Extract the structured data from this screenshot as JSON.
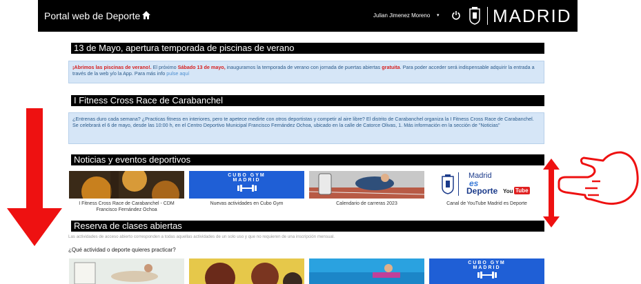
{
  "header": {
    "title": "Portal web de Deporte",
    "user_name": "Julian Jimenez Moreno",
    "caret": "▾",
    "brand": "MADRID"
  },
  "sections": {
    "pools": {
      "heading": "13 de Mayo, apertura temporada de piscinas de verano",
      "p1_highlight": "¡Abrimos las piscinas de verano!.",
      "p1_a": " El próximo ",
      "p1_date": "Sábado 13 de mayo,",
      "p1_b": " inauguramos la temporada de verano con jornada de puertas abiertas ",
      "p1_free": "gratuita",
      "p1_c": ". Para poder acceder será indispensable adquirir la entrada a través de la web y/o la App. Para más info ",
      "p1_link": "pulse aquí"
    },
    "fitness": {
      "heading": "I Fitness Cross Race de Carabanchel",
      "body": "¿Entrenas duro cada semana? ¿Practicas fitness en interiores, pero te apetece medirte con otros deportistas y competir al aire libre? El distrito de Carabanchel organiza la I Fitness Cross Race de Carabanchel. Se celebrará el 6 de mayo, desde las 10:00 h, en el Centro Deportivo Municipal Francisco Fernández Ochoa, ubicado en la calle de Catorce Olivas, 1. Más información en la sección de \"Noticias\""
    },
    "news": {
      "heading": "Noticias y eventos deportivos",
      "cards": [
        {
          "caption": "I Fitness Cross Race de Carabanchel - CDM Francisco Fernández Ochoa"
        },
        {
          "caption": "Nuevas actividades en Cubo Gym",
          "banner_line1": "CUBO GYM",
          "banner_line2": "MADRID"
        },
        {
          "caption": "Calendario de carreras 2023"
        },
        {
          "caption": "Canal de YouTube Madrid es Deporte",
          "logo_line1": "Madrid",
          "logo_line2": "es",
          "logo_line3": "Deporte",
          "yt_you": "You",
          "yt_tube": "Tube"
        }
      ]
    },
    "classes": {
      "heading": "Reserva de clases abiertas",
      "note": "Las actividades de acceso abierto corresponden a todas aquellas actividades de un solo uso y que no requieren de una inscripción mensual.",
      "question": "¿Qué actividad o deporte quieres practicar?",
      "card4_line1": "CUBO GYM",
      "card4_line2": "MADRID"
    }
  },
  "colors": {
    "topbar": "#000000",
    "notice_bg": "#d6e6f7",
    "notice_text": "#2a5a8a",
    "highlight_red": "#d62020",
    "cubo_blue": "#1f5fd6",
    "arrow_red": "#ee1111"
  },
  "icons": [
    "home-icon",
    "power-icon",
    "madrid-shield-icon",
    "dumbbell-icon",
    "arrow-down-overlay",
    "arrow-updown-overlay",
    "hand-swipe-overlay"
  ]
}
